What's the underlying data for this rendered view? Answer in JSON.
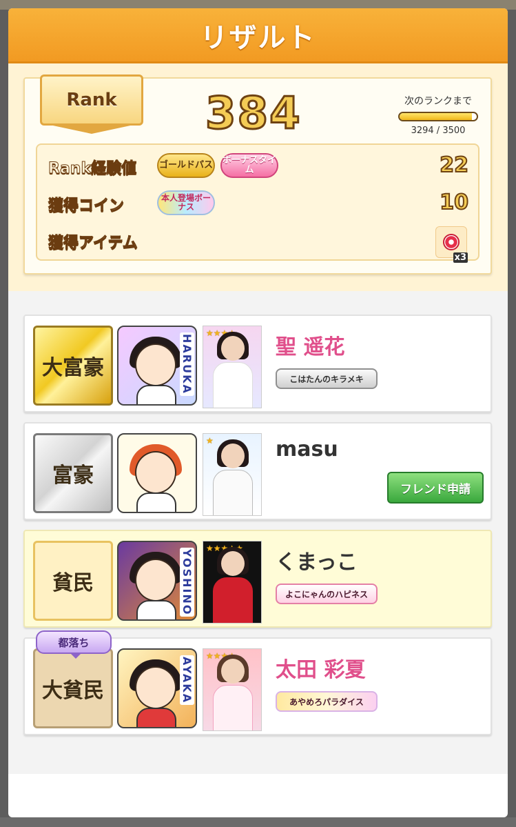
{
  "header": {
    "title": "リザルト"
  },
  "rank": {
    "badge_label": "Rank",
    "level": "384",
    "next_label": "次のランクまで",
    "progress_text": "3294 / 3500",
    "progress_fraction": 0.94
  },
  "stats": {
    "exp_label": "Rank経験値",
    "exp_value": "22",
    "gold_pass_label": "ゴールドパス",
    "bonus_time_label": "ボーナスタイム",
    "coin_label": "獲得コイン",
    "coin_value": "10",
    "self_bonus_label": "本人登場ボーナス",
    "item_label": "獲得アイテム",
    "item_count": "x3",
    "item_icon": "red-gem-icon"
  },
  "players": [
    {
      "title": "大富豪",
      "avatar_name": "HARUKA",
      "name": "聖 遥花",
      "tag": "こはたんのキラメキ",
      "card_stars": "★★★★"
    },
    {
      "title": "富豪",
      "avatar_name": "",
      "name": "masu",
      "friend_button": "フレンド申請",
      "card_stars": "★"
    },
    {
      "title": "貧民",
      "avatar_name": "YOSHINO",
      "name": "くまっこ",
      "tag": "よこにゃんのハピネス",
      "card_stars": "★★★★★"
    },
    {
      "title": "大貧民",
      "falling_label": "都落ち",
      "avatar_name": "AYAKA",
      "name": "太田 彩夏",
      "tag": "あやめろパラダイス",
      "card_stars": "★★★★"
    }
  ],
  "colors": {
    "header": "#f29a22",
    "name_pink": "#e04f8b",
    "friend_green": "#3aa83d"
  }
}
